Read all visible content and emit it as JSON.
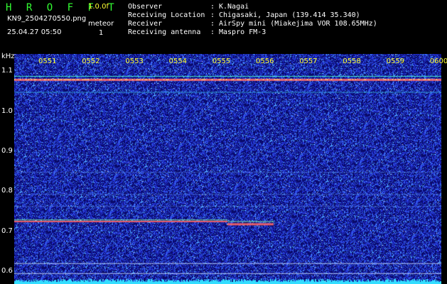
{
  "app": {
    "logo": "H R O F F T",
    "version": "1.0.0f",
    "filename": "KN9_2504270550.png",
    "timestamp": "25.04.27 05:50",
    "category_label": "meteor",
    "category_value": "1"
  },
  "info": {
    "rows": [
      {
        "label": "Observer",
        "value": "K.Nagai"
      },
      {
        "label": "Receiving Location",
        "value": "Chigasaki, Japan (139.414 35.340)"
      },
      {
        "label": "Receiver",
        "value": "AirSpy mini (Miakejima VOR 108.65MHz)"
      },
      {
        "label": "Receiving antenna",
        "value": "Maspro FM-3"
      }
    ],
    "separator": ":"
  },
  "chart_data": {
    "type": "heatmap",
    "ylabel": "kHz",
    "y_ticks": [
      "1.1",
      "1.0",
      "0.9",
      "0.8",
      "0.7",
      "0.6"
    ],
    "y_tick_values": [
      1.1,
      1.0,
      0.9,
      0.8,
      0.7,
      0.6
    ],
    "ylim": [
      0.57,
      1.145
    ],
    "x_ticks": [
      "0551",
      "0552",
      "0553",
      "0554",
      "0555",
      "0556",
      "0557",
      "0558",
      "0559",
      "0600"
    ],
    "xlim_minutes": [
      0,
      10
    ],
    "colors": {
      "background": "#0a0a6e",
      "noise": "#3a4aff",
      "carrier": "#ff5a5a",
      "line": "#33ffcc",
      "floor": "#33ddff"
    }
  }
}
